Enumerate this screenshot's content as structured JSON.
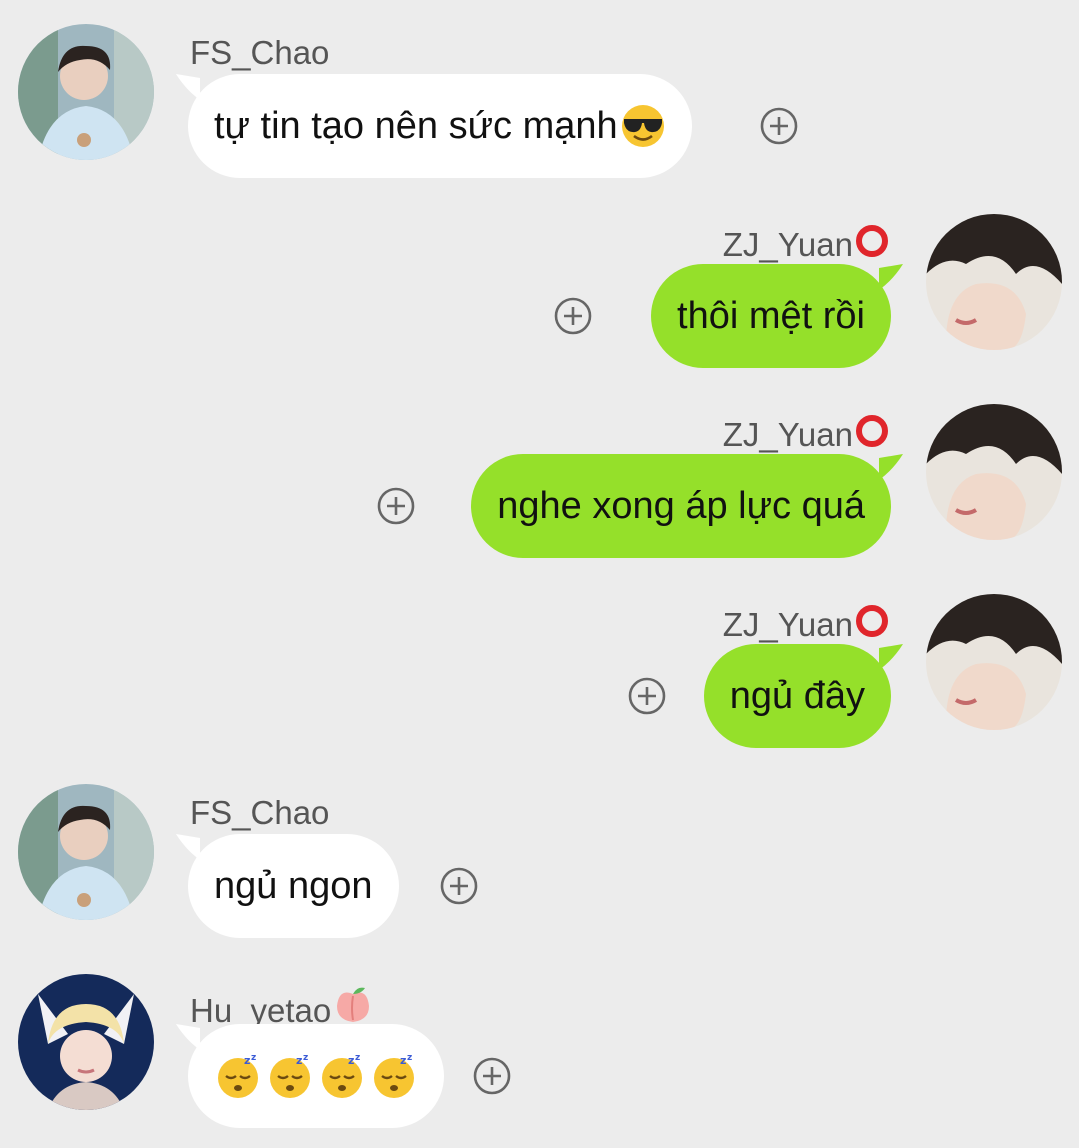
{
  "messages": [
    {
      "sender": "FS_Chao",
      "text": "tự tin tạo nên sức mạnh",
      "emoji": "smiling-face-with-sunglasses"
    },
    {
      "sender": "ZJ_Yuan",
      "text": "thôi mệt rồi",
      "badge": "red-circle"
    },
    {
      "sender": "ZJ_Yuan",
      "text": "nghe xong áp lực quá",
      "badge": "red-circle"
    },
    {
      "sender": "ZJ_Yuan",
      "text": "ngủ đây",
      "badge": "red-circle"
    },
    {
      "sender": "FS_Chao",
      "text": "ngủ ngon"
    },
    {
      "sender": "Hu_yetao",
      "badge": "peach",
      "emoji": "sleeping-face",
      "emoji_count": 4
    }
  ],
  "colors": {
    "background": "#ececec",
    "incoming_bubble": "#ffffff",
    "outgoing_bubble": "#95e02a",
    "sender_name": "#555555"
  },
  "icons": {
    "add": "plus-circle-icon",
    "badge_red": "red-circle-icon",
    "badge_peach": "peach-icon"
  }
}
